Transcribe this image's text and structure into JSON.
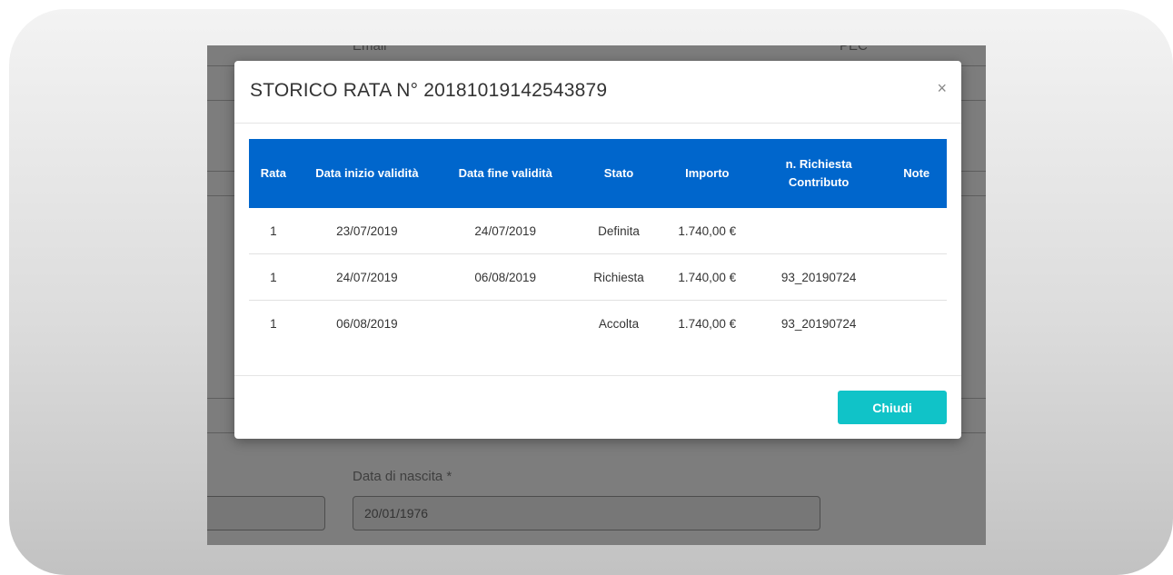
{
  "background_form": {
    "email_label": "Email",
    "pec_label": "PEC",
    "birth_date_label": "Data di nascita *",
    "birth_date_value": "20/01/1976"
  },
  "modal": {
    "title": "STORICO RATA N° 20181019142543879",
    "close_symbol": "×",
    "columns": [
      "Rata",
      "Data inizio validità",
      "Data fine validità",
      "Stato",
      "Importo",
      "n. Richiesta Contributo",
      "Note"
    ],
    "rows": [
      [
        "1",
        "23/07/2019",
        "24/07/2019",
        "Definita",
        "1.740,00 €",
        "",
        ""
      ],
      [
        "1",
        "24/07/2019",
        "06/08/2019",
        "Richiesta",
        "1.740,00 €",
        "93_20190724",
        ""
      ],
      [
        "1",
        "06/08/2019",
        "",
        "Accolta",
        "1.740,00 €",
        "93_20190724",
        ""
      ]
    ],
    "footer_button": "Chiudi"
  },
  "colors": {
    "table_header": "#0066cc",
    "button": "#10c3c8",
    "overlay": "#7d7d7d"
  }
}
